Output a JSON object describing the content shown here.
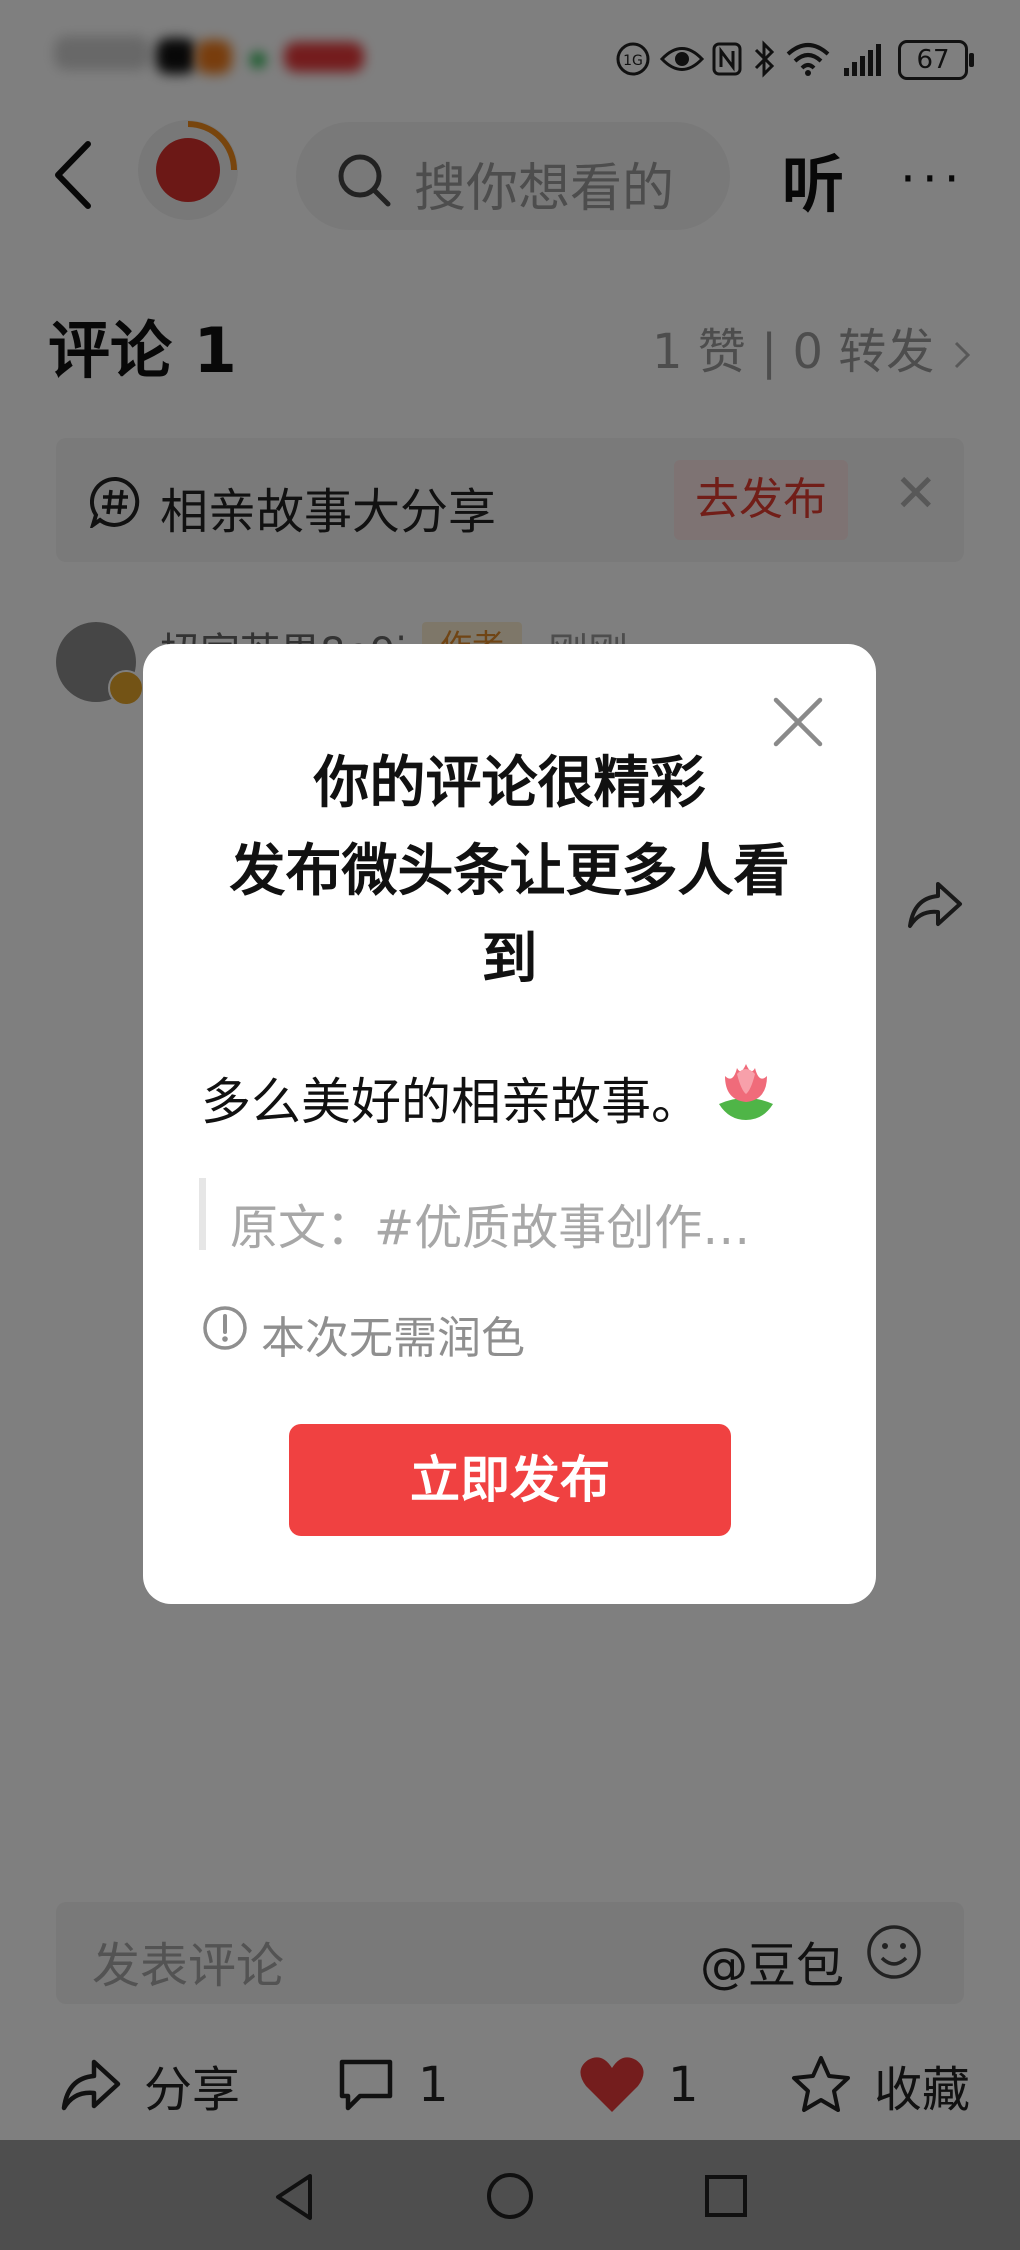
{
  "status_bar": {
    "battery": "67"
  },
  "header": {
    "search_placeholder": "搜你想看的",
    "listen_label": "听",
    "more_label": "···"
  },
  "comments": {
    "title": "评论 1",
    "stats": "1 赞 | 0 转发",
    "author": "扭家芒果8e9i",
    "author_tag": "作者",
    "time": "刚刚"
  },
  "topic": {
    "text": "相亲故事大分享",
    "post_button": "去发布"
  },
  "modal": {
    "title_line1": "你的评论很精彩",
    "title_line2": "发布微头条让更多人看",
    "title_line3": "到",
    "comment_text": "多么美好的相亲故事。",
    "quote_text": "原文：#优质故事创作…",
    "hint": "本次无需润色",
    "publish_button": "立即发布"
  },
  "input_bar": {
    "placeholder": "发表评论",
    "doubao": "@豆包"
  },
  "actions": {
    "share": "分享",
    "comment_count": "1",
    "like_count": "1",
    "favorite": "收藏"
  },
  "colors": {
    "accent_red": "#f04141",
    "post_tag_bg": "#fde7e6",
    "overlay": "rgba(0,0,0,0.5)"
  }
}
